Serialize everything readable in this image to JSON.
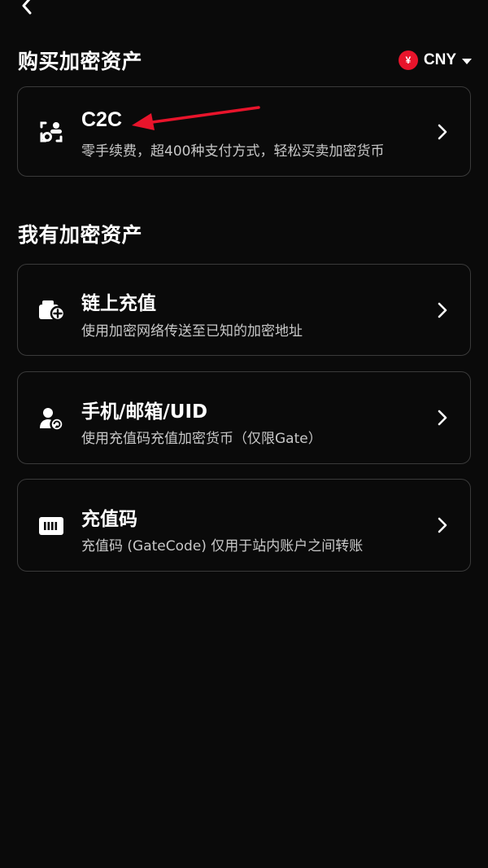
{
  "colors": {
    "background": "#0a0a0a",
    "card_border": "#3a3a3a",
    "accent_red": "#e8142b",
    "text_primary": "#ffffff",
    "text_secondary": "#c8c8c8"
  },
  "header": {
    "back_icon": "chevron-left-icon"
  },
  "currency": {
    "badge": "¥",
    "label": "CNY",
    "dropdown_icon": "caret-down-icon"
  },
  "sections": {
    "buy_title": "购买加密资产",
    "have_title": "我有加密资产"
  },
  "cards": [
    {
      "icon": "c2c-exchange-icon",
      "title": "C2C",
      "desc": "零手续费，超400种支付方式，轻松买卖加密货币"
    },
    {
      "icon": "wallet-add-icon",
      "title": "链上充值",
      "desc": "使用加密网络传送至已知的加密地址"
    },
    {
      "icon": "user-transfer-icon",
      "title": "手机/邮箱/UID",
      "desc": "使用充值码充值加密货币（仅限Gate）"
    },
    {
      "icon": "voucher-code-icon",
      "title": "充值码",
      "desc": "充值码 (GateCode) 仅用于站内账户之间转账"
    }
  ],
  "annotation": {
    "arrow_icon": "red-arrow-icon",
    "color": "#e8142b"
  }
}
